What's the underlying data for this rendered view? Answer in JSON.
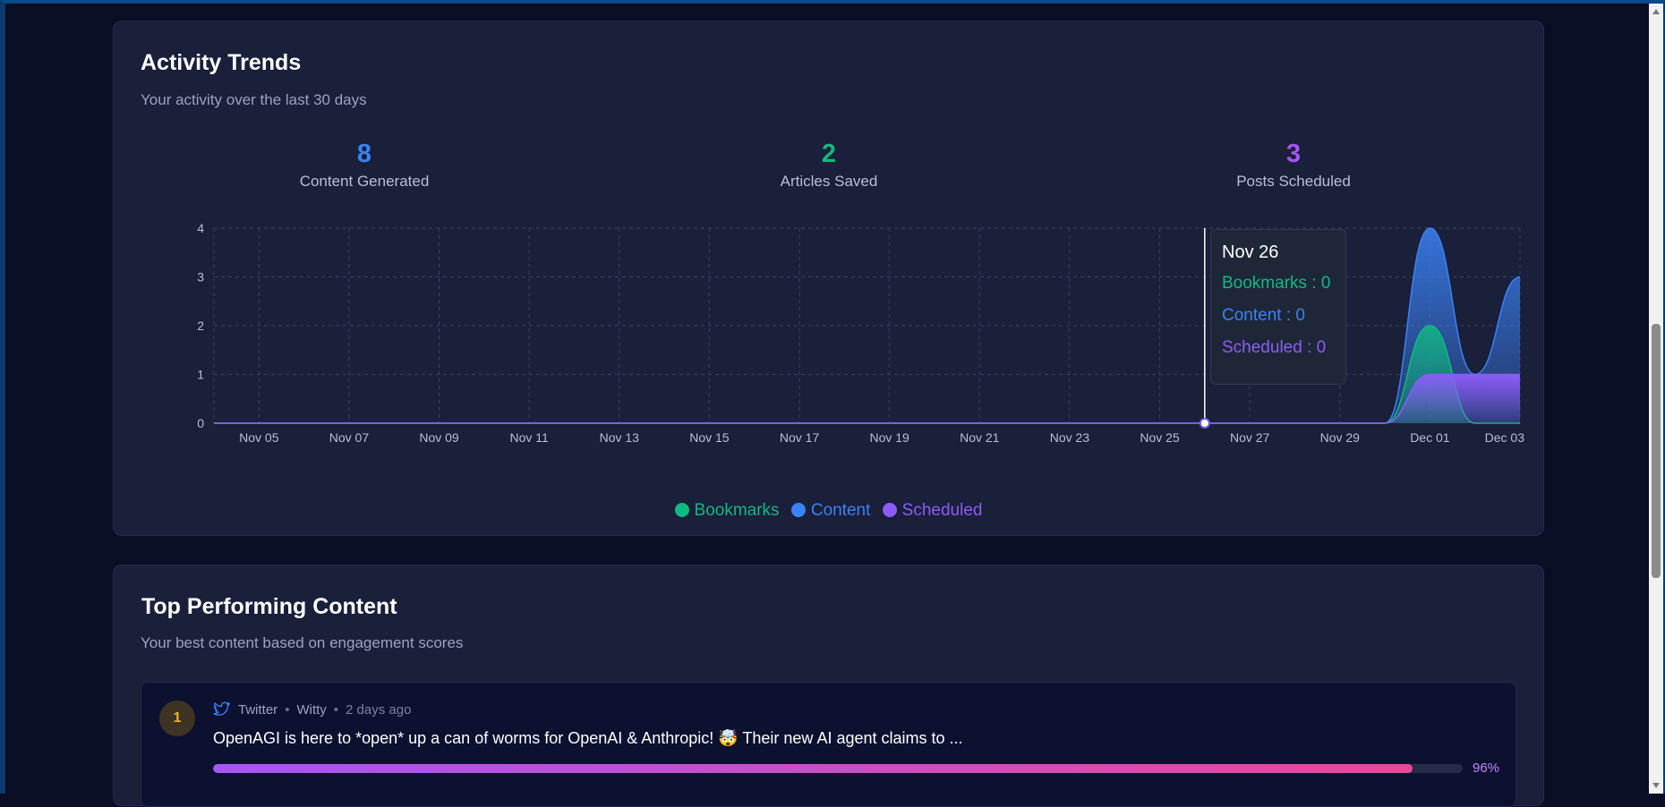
{
  "activity": {
    "title": "Activity Trends",
    "subtitle": "Your activity over the last 30 days",
    "stats": [
      {
        "value": "8",
        "label": "Content Generated",
        "color": "#3b82f6"
      },
      {
        "value": "2",
        "label": "Articles Saved",
        "color": "#10b981"
      },
      {
        "value": "3",
        "label": "Posts Scheduled",
        "color": "#a855f7"
      }
    ],
    "tooltip": {
      "date": "Nov 26",
      "bookmarks": "Bookmarks : 0",
      "content": "Content : 0",
      "scheduled": "Scheduled : 0"
    },
    "legend": [
      {
        "label": "Bookmarks",
        "color": "#10b981"
      },
      {
        "label": "Content",
        "color": "#3b82f6"
      },
      {
        "label": "Scheduled",
        "color": "#8b5cf6"
      }
    ]
  },
  "chart_data": {
    "type": "area",
    "x": [
      "Nov 04",
      "Nov 05",
      "Nov 06",
      "Nov 07",
      "Nov 08",
      "Nov 09",
      "Nov 10",
      "Nov 11",
      "Nov 12",
      "Nov 13",
      "Nov 14",
      "Nov 15",
      "Nov 16",
      "Nov 17",
      "Nov 18",
      "Nov 19",
      "Nov 20",
      "Nov 21",
      "Nov 22",
      "Nov 23",
      "Nov 24",
      "Nov 25",
      "Nov 26",
      "Nov 27",
      "Nov 28",
      "Nov 29",
      "Nov 30",
      "Dec 01",
      "Dec 02",
      "Dec 03"
    ],
    "x_tick_labels": [
      "Nov 05",
      "Nov 07",
      "Nov 09",
      "Nov 11",
      "Nov 13",
      "Nov 15",
      "Nov 17",
      "Nov 19",
      "Nov 21",
      "Nov 23",
      "Nov 25",
      "Nov 27",
      "Nov 29",
      "Dec 01",
      "Dec 03"
    ],
    "series": [
      {
        "name": "Bookmarks",
        "color": "#10b981",
        "values": [
          0,
          0,
          0,
          0,
          0,
          0,
          0,
          0,
          0,
          0,
          0,
          0,
          0,
          0,
          0,
          0,
          0,
          0,
          0,
          0,
          0,
          0,
          0,
          0,
          0,
          0,
          0,
          2,
          0,
          0
        ]
      },
      {
        "name": "Content",
        "color": "#3b82f6",
        "values": [
          0,
          0,
          0,
          0,
          0,
          0,
          0,
          0,
          0,
          0,
          0,
          0,
          0,
          0,
          0,
          0,
          0,
          0,
          0,
          0,
          0,
          0,
          0,
          0,
          0,
          0,
          0,
          4,
          1,
          3
        ]
      },
      {
        "name": "Scheduled",
        "color": "#8b5cf6",
        "values": [
          0,
          0,
          0,
          0,
          0,
          0,
          0,
          0,
          0,
          0,
          0,
          0,
          0,
          0,
          0,
          0,
          0,
          0,
          0,
          0,
          0,
          0,
          0,
          0,
          0,
          0,
          0,
          1,
          1,
          1
        ]
      }
    ],
    "y_ticks": [
      0,
      1,
      2,
      3,
      4
    ],
    "ylim": [
      0,
      4
    ],
    "grid": true,
    "active_x": "Nov 26"
  },
  "top_content": {
    "title": "Top Performing Content",
    "subtitle": "Your best content based on engagement scores",
    "items": [
      {
        "rank": "1",
        "platform": "Twitter",
        "tone": "Witty",
        "time": "2 days ago",
        "text": "OpenAGI is here to *open* up a can of worms for OpenAI & Anthropic! 🤯 Their new AI agent claims to ...",
        "score_label": "96%",
        "score": 96
      }
    ]
  }
}
